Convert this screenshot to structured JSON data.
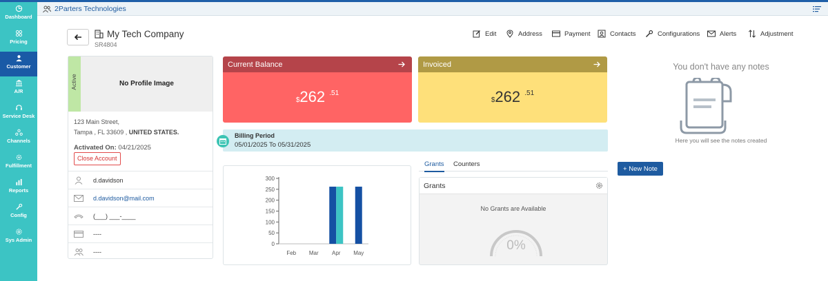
{
  "header": {
    "org_name": "2Parters Technologies"
  },
  "sidebar": {
    "items": [
      {
        "label": "Dashboard",
        "icon": "dashboard-icon"
      },
      {
        "label": "Pricing",
        "icon": "pricing-icon"
      },
      {
        "label": "Customer",
        "icon": "customer-icon",
        "active": true
      },
      {
        "label": "A/R",
        "icon": "bank-icon"
      },
      {
        "label": "Service Desk",
        "icon": "headset-icon"
      },
      {
        "label": "Channels",
        "icon": "channels-icon"
      },
      {
        "label": "Fulfillment",
        "icon": "gear-icon"
      },
      {
        "label": "Reports",
        "icon": "bar-chart-icon"
      },
      {
        "label": "Config",
        "icon": "wrench-icon"
      },
      {
        "label": "Sys Admin",
        "icon": "cog-icon"
      }
    ]
  },
  "company": {
    "name": "My Tech Company",
    "id": "SR4804"
  },
  "actions": {
    "edit": "Edit",
    "address": "Address",
    "payment": "Payment",
    "contacts": "Contacts",
    "configurations": "Configurations",
    "alerts": "Alerts",
    "adjustment": "Adjustment"
  },
  "profile": {
    "status": "Active",
    "no_image": "No Profile Image",
    "street": "123 Main Street,",
    "city_line": "Tampa , FL 33609 ,",
    "country": "UNITED STATES.",
    "activated_label": "Activated On:",
    "activated_date": "04/21/2025",
    "close_button": "Close Account",
    "username": "d.davidson",
    "email": "d.davidson@mail.com",
    "phone": "(___) ___-____",
    "card": "----",
    "group": "----"
  },
  "balance": {
    "current_title": "Current Balance",
    "current_currency": "$",
    "current_whole": "262",
    "current_cents": ".51",
    "invoiced_title": "Invoiced",
    "invoiced_currency": "$",
    "invoiced_whole": "262",
    "invoiced_cents": ".51"
  },
  "billing": {
    "title": "Billing Period",
    "dates": "05/01/2025 To 05/31/2025"
  },
  "chart_data": {
    "type": "bar",
    "categories": [
      "Feb",
      "Mar",
      "Apr",
      "May"
    ],
    "series": [
      {
        "values": [
          0,
          0,
          262,
          262
        ],
        "color": "#1550a3"
      },
      {
        "values": [
          0,
          0,
          262,
          0
        ],
        "color": "#3cc4c4"
      }
    ],
    "yticks": [
      "0",
      "50",
      "100",
      "150",
      "200",
      "250",
      "300"
    ],
    "ylim": [
      0,
      300
    ]
  },
  "grants": {
    "tab_grants": "Grants",
    "tab_counters": "Counters",
    "title": "Grants",
    "empty": "No Grants are Available",
    "gauge_value": "0%"
  },
  "notes": {
    "empty_title": "You don't have any notes",
    "empty_sub": "Here you will see the notes created",
    "new_button": "+ New Note"
  }
}
